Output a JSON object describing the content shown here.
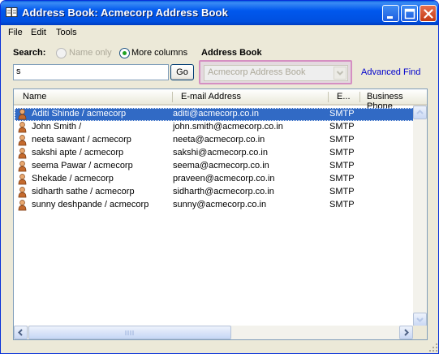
{
  "window": {
    "title": "Address Book: Acmecorp Address Book"
  },
  "menu": [
    "File",
    "Edit",
    "Tools"
  ],
  "search": {
    "label": "Search:",
    "options": [
      "Name only",
      "More columns"
    ],
    "selected_option": "More columns",
    "value": "s",
    "go_label": "Go"
  },
  "address_book": {
    "label": "Address Book",
    "selected": "Acmecorp Address Book",
    "advanced_find": "Advanced Find"
  },
  "columns": [
    "Name",
    "E-mail Address",
    "E...",
    "Business Phone"
  ],
  "rows": [
    {
      "name": "Aditi Shinde / acmecorp",
      "email": "aditi@acmecorp.co.in",
      "type": "SMTP",
      "selected": true
    },
    {
      "name": "John Smith /",
      "email": "john.smith@acmecorp.co.in",
      "type": "SMTP",
      "selected": false
    },
    {
      "name": "neeta sawant / acmecorp",
      "email": "neeta@acmecorp.co.in",
      "type": "SMTP",
      "selected": false
    },
    {
      "name": "sakshi apte / acmecorp",
      "email": "sakshi@acmecorp.co.in",
      "type": "SMTP",
      "selected": false
    },
    {
      "name": "seema Pawar / acmecorp",
      "email": "seema@acmecorp.co.in",
      "type": "SMTP",
      "selected": false
    },
    {
      "name": "Shekade  / acmecorp",
      "email": "praveen@acmecorp.co.in",
      "type": "SMTP",
      "selected": false
    },
    {
      "name": "sidharth sathe / acmecorp",
      "email": "sidharth@acmecorp.co.in",
      "type": "SMTP",
      "selected": false
    },
    {
      "name": "sunny deshpande / acmecorp",
      "email": "sunny@acmecorp.co.in",
      "type": "SMTP",
      "selected": false
    }
  ],
  "icons": {
    "title": "address-book-icon",
    "row": "contact-person-icon"
  },
  "colors": {
    "titlebar": "#0058ee",
    "selection": "#316ac5",
    "link": "#0000cc",
    "highlight_border": "#d58fc2"
  }
}
